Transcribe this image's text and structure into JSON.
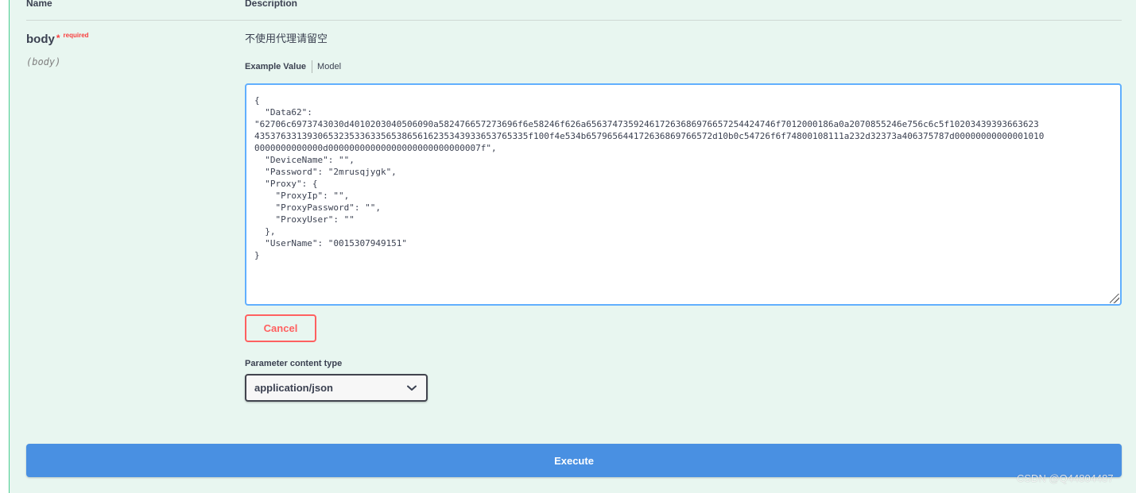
{
  "table": {
    "col_name": "Name",
    "col_description": "Description"
  },
  "param": {
    "name": "body",
    "required_star": "*",
    "required_text": "required",
    "in": "(body)",
    "description": "不使用代理请留空"
  },
  "tabs": {
    "example_value": "Example Value",
    "model": "Model"
  },
  "editor": {
    "value": "{\n  \"Data62\":\n\"62706c6973743030d4010203040506090a582476657273696f6e58246f626a656374735924617263686976657254424746f7012000186a0a2070855246e756c6c5f10203439393663623\n4353763313930653235336335653865616235343933653765335f100f4e534b657965644172636869766572d10b0c54726f6f74800108111a232d32373a406375787d00000000000001010\n0000000000000d00000000000000000000000000007f\",\n  \"DeviceName\": \"\",\n  \"Password\": \"2mrusqjygk\",\n  \"Proxy\": {\n    \"ProxyIp\": \"\",\n    \"ProxyPassword\": \"\",\n    \"ProxyUser\": \"\"\n  },\n  \"UserName\": \"0015307949151\"\n}"
  },
  "actions": {
    "cancel_label": "Cancel",
    "execute_label": "Execute"
  },
  "content_type": {
    "label": "Parameter content type",
    "selected": "application/json"
  },
  "watermark": "CSDN @Q44804487",
  "icons": {
    "select_arrow": "chevron-down-icon"
  },
  "colors": {
    "panel_bg": "#e8f6f0",
    "panel_border": "#49cc90",
    "editor_border": "#61affe",
    "cancel": "#ff6060",
    "execute": "#4990e2",
    "required": "#f93e3e"
  }
}
